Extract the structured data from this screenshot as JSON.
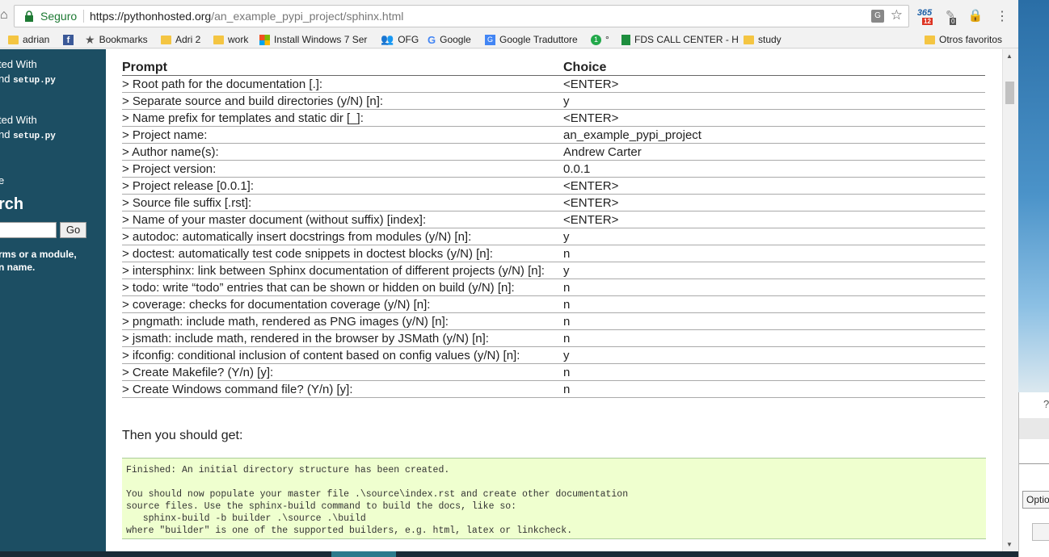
{
  "address_bar": {
    "secure_label": "Seguro",
    "url_host": "https://pythonhosted.org",
    "url_path": "/an_example_pypi_project/sphinx.html",
    "ext_365_badge": "12",
    "ext_pin_badge": "0"
  },
  "bookmarks": {
    "adrian": "adrian",
    "bookmarks": "Bookmarks",
    "adri2": "Adri 2",
    "work": "work",
    "install_windows": "Install Windows 7 Ser",
    "ofg": "OFG",
    "google": "Google",
    "traduttore": "Google Traduttore",
    "degree": "°",
    "fds": "FDS CALL CENTER - H",
    "study": "study",
    "otros": "Otros favoritos"
  },
  "sidebar": {
    "line1": "ted With",
    "line1_code_prefix": "nd ",
    "line1_code": "setup.py",
    "line2": "ted With",
    "line2_code_prefix": "nd ",
    "line2_code": "setup.py",
    "line3": "e",
    "search_title": "rch",
    "go_label": "Go",
    "hint1": "rms or a module,",
    "hint2": "n name."
  },
  "table": {
    "header": {
      "prompt": "Prompt",
      "choice": "Choice"
    },
    "rows": [
      {
        "prompt": "> Root path for the documentation [.]:",
        "choice": "<ENTER>"
      },
      {
        "prompt": "> Separate source and build directories (y/N) [n]:",
        "choice": "y"
      },
      {
        "prompt": "> Name prefix for templates and static dir [_]:",
        "choice": "<ENTER>"
      },
      {
        "prompt": "> Project name:",
        "choice": "an_example_pypi_project"
      },
      {
        "prompt": "> Author name(s):",
        "choice": "Andrew Carter"
      },
      {
        "prompt": "> Project version:",
        "choice": "0.0.1"
      },
      {
        "prompt": "> Project release [0.0.1]:",
        "choice": "<ENTER>"
      },
      {
        "prompt": "> Source file suffix [.rst]:",
        "choice": "<ENTER>"
      },
      {
        "prompt": "> Name of your master document (without suffix) [index]:",
        "choice": "<ENTER>"
      },
      {
        "prompt": "> autodoc: automatically insert docstrings from modules (y/N) [n]:",
        "choice": "y"
      },
      {
        "prompt": "> doctest: automatically test code snippets in doctest blocks (y/N) [n]:",
        "choice": "n"
      },
      {
        "prompt": "> intersphinx: link between Sphinx documentation of different projects (y/N) [n]:",
        "choice": "y"
      },
      {
        "prompt": "> todo: write “todo” entries that can be shown or hidden on build (y/N) [n]:",
        "choice": "n"
      },
      {
        "prompt": "> coverage: checks for documentation coverage (y/N) [n]:",
        "choice": "n"
      },
      {
        "prompt": "> pngmath: include math, rendered as PNG images (y/N) [n]:",
        "choice": "n"
      },
      {
        "prompt": "> jsmath: include math, rendered in the browser by JSMath (y/N) [n]:",
        "choice": "n"
      },
      {
        "prompt": "> ifconfig: conditional inclusion of content based on config values (y/N) [n]:",
        "choice": "y"
      },
      {
        "prompt": "> Create Makefile? (Y/n) [y]:",
        "choice": "n"
      },
      {
        "prompt": "> Create Windows command file? (Y/n) [y]:",
        "choice": "n"
      }
    ]
  },
  "then_text": "Then you should get:",
  "output": "Finished: An initial directory structure has been created.\n\nYou should now populate your master file .\\source\\index.rst and create other documentation\nsource files. Use the sphinx-build command to build the docs, like so:\n   sphinx-build -b builder .\\source .\\build\nwhere \"builder\" is one of the supported builders, e.g. html, latex or linkcheck.",
  "bg_window": {
    "question": "?",
    "option_label": "Optio"
  }
}
